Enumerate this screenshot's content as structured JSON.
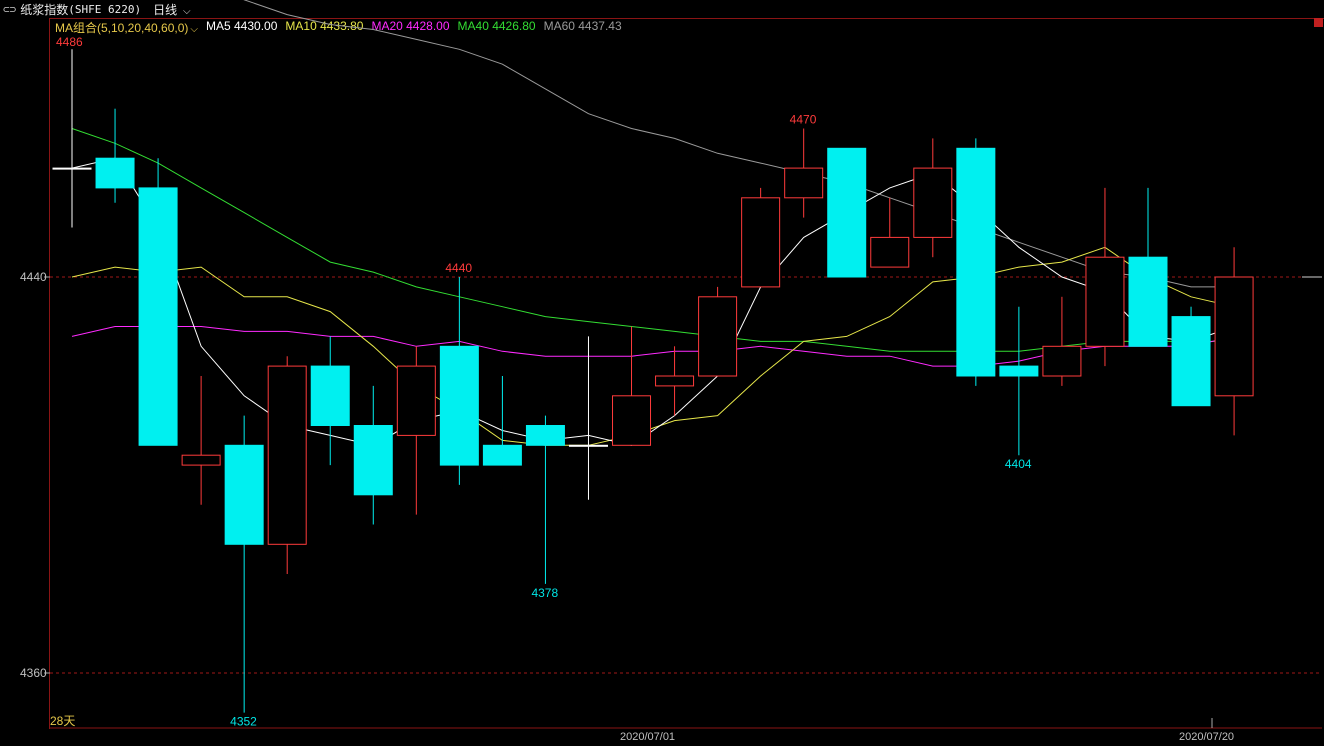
{
  "header": {
    "link_icon": "⊂⊃",
    "instrument": "纸浆指数",
    "code": "(SHFE 6220)",
    "period": "日线",
    "period_caret": "⌵"
  },
  "legend": {
    "ma_group_label": "MA组合(5,10,20,40,60,0)",
    "items": [
      {
        "label": "MA5 4430.00",
        "color": "#ffffff"
      },
      {
        "label": "MA10 4433.80",
        "color": "#e6e64a"
      },
      {
        "label": "MA20 4428.00",
        "color": "#ff2bff"
      },
      {
        "label": "MA40 4426.80",
        "color": "#33dd33"
      },
      {
        "label": "MA60 4437.43",
        "color": "#9a9a9a"
      }
    ]
  },
  "axis": {
    "price_ticks": [
      "4440",
      "4360"
    ],
    "dates": [
      "2020/07/01",
      "2020/07/20"
    ],
    "range_label": "28天"
  },
  "colors": {
    "up": "#ff3b3b",
    "down": "#00f0f0",
    "grid": "#a01818",
    "bg": "#000000"
  },
  "chart_data": {
    "type": "candlestick",
    "ylim": [
      4350,
      4500
    ],
    "candles": [
      {
        "o": 4462,
        "h": 4486,
        "l": 4450,
        "c": 4462
      },
      {
        "o": 4464,
        "h": 4474,
        "l": 4455,
        "c": 4458
      },
      {
        "o": 4458,
        "h": 4464,
        "l": 4406,
        "c": 4406
      },
      {
        "o": 4402,
        "h": 4420,
        "l": 4394,
        "c": 4404
      },
      {
        "o": 4406,
        "h": 4412,
        "l": 4352,
        "c": 4386
      },
      {
        "o": 4386,
        "h": 4424,
        "l": 4380,
        "c": 4422
      },
      {
        "o": 4422,
        "h": 4428,
        "l": 4402,
        "c": 4410
      },
      {
        "o": 4410,
        "h": 4418,
        "l": 4390,
        "c": 4396
      },
      {
        "o": 4408,
        "h": 4426,
        "l": 4392,
        "c": 4422
      },
      {
        "o": 4426,
        "h": 4440,
        "l": 4398,
        "c": 4402
      },
      {
        "o": 4406,
        "h": 4420,
        "l": 4402,
        "c": 4402
      },
      {
        "o": 4410,
        "h": 4412,
        "l": 4378,
        "c": 4406
      },
      {
        "o": 4406,
        "h": 4428,
        "l": 4395,
        "c": 4406
      },
      {
        "o": 4406,
        "h": 4430,
        "l": 4406,
        "c": 4416
      },
      {
        "o": 4418,
        "h": 4426,
        "l": 4412,
        "c": 4420
      },
      {
        "o": 4420,
        "h": 4438,
        "l": 4420,
        "c": 4436
      },
      {
        "o": 4438,
        "h": 4458,
        "l": 4438,
        "c": 4456
      },
      {
        "o": 4456,
        "h": 4470,
        "l": 4452,
        "c": 4462
      },
      {
        "o": 4466,
        "h": 4466,
        "l": 4440,
        "c": 4440
      },
      {
        "o": 4442,
        "h": 4456,
        "l": 4442,
        "c": 4448
      },
      {
        "o": 4448,
        "h": 4468,
        "l": 4444,
        "c": 4462
      },
      {
        "o": 4466,
        "h": 4468,
        "l": 4418,
        "c": 4420
      },
      {
        "o": 4422,
        "h": 4434,
        "l": 4404,
        "c": 4420
      },
      {
        "o": 4420,
        "h": 4436,
        "l": 4418,
        "c": 4426
      },
      {
        "o": 4426,
        "h": 4458,
        "l": 4422,
        "c": 4444
      },
      {
        "o": 4444,
        "h": 4458,
        "l": 4426,
        "c": 4426
      },
      {
        "o": 4432,
        "h": 4434,
        "l": 4414,
        "c": 4414
      },
      {
        "o": 4416,
        "h": 4446,
        "l": 4408,
        "c": 4440
      }
    ],
    "annotations": [
      {
        "index": 0,
        "value": 4486,
        "label": "4486",
        "color": "#ff3b3b",
        "pos": "above"
      },
      {
        "index": 4,
        "value": 4352,
        "label": "4352",
        "color": "#00e5e5",
        "pos": "below"
      },
      {
        "index": 9,
        "value": 4440,
        "label": "4440",
        "color": "#ff3b3b",
        "pos": "above"
      },
      {
        "index": 11,
        "value": 4378,
        "label": "4378",
        "color": "#00e5e5",
        "pos": "below"
      },
      {
        "index": 17,
        "value": 4470,
        "label": "4470",
        "color": "#ff3b3b",
        "pos": "above"
      },
      {
        "index": 22,
        "value": 4404,
        "label": "4404",
        "color": "#00e5e5",
        "pos": "below"
      }
    ],
    "ma5": [
      4462,
      4464,
      4450,
      4426,
      4416,
      4410,
      4408,
      4406,
      4411,
      4413,
      4409,
      4407,
      4408,
      4406,
      4412,
      4420,
      4438,
      4448,
      4453,
      4458,
      4461,
      4454,
      4446,
      4440,
      4437,
      4428,
      4427,
      4430
    ],
    "ma10": [
      4440,
      4442,
      4441,
      4442,
      4436,
      4436,
      4433,
      4426,
      4418,
      4413,
      4407,
      4406,
      4406,
      4408,
      4411,
      4412,
      4420,
      4427,
      4428,
      4432,
      4439,
      4440,
      4442,
      4443,
      4446,
      4440,
      4436,
      4434
    ],
    "ma20": [
      4428,
      4430,
      4430,
      4430,
      4429,
      4429,
      4428,
      4428,
      4426,
      4427,
      4425,
      4424,
      4424,
      4424,
      4425,
      4425,
      4426,
      4425,
      4424,
      4424,
      4422,
      4422,
      4423,
      4425,
      4426,
      4426,
      4426,
      4428
    ],
    "ma40": [
      4470,
      4467,
      4463,
      4458,
      4453,
      4448,
      4443,
      4441,
      4438,
      4436,
      4434,
      4432,
      4431,
      4430,
      4429,
      4428,
      4427,
      4427,
      4426,
      4425,
      4425,
      4425,
      4425,
      4426,
      4427,
      4427,
      4427,
      4427
    ],
    "ma60": [
      4512,
      4508,
      4504,
      4500,
      4496,
      4493,
      4491,
      4490,
      4488,
      4486,
      4483,
      4478,
      4473,
      4470,
      4468,
      4465,
      4463,
      4461,
      4459,
      4456,
      4453,
      4450,
      4447,
      4444,
      4441,
      4440,
      4438,
      4438
    ]
  }
}
